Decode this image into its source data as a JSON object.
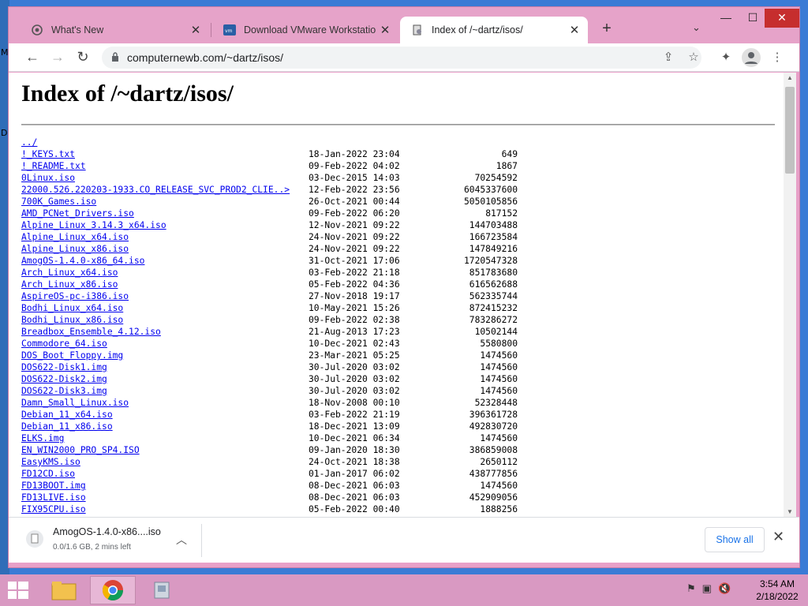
{
  "browser": {
    "tabs": [
      {
        "title": "What's New",
        "icon": "chrome-icon"
      },
      {
        "title": "Download VMware Workstation",
        "icon": "vmware-icon"
      },
      {
        "title": "Index of /~dartz/isos/",
        "icon": "page-icon"
      }
    ],
    "url": "computernewb.com/~dartz/isos/"
  },
  "page": {
    "title": "Index of /~dartz/isos/",
    "parent_link": "../",
    "entries": [
      {
        "name": "!_KEYS.txt",
        "date": "18-Jan-2022 23:04",
        "size": "649"
      },
      {
        "name": "!_README.txt",
        "date": "09-Feb-2022 04:02",
        "size": "1867"
      },
      {
        "name": "0Linux.iso",
        "date": "03-Dec-2015 14:03",
        "size": "70254592"
      },
      {
        "name": "22000.526.220203-1933.CO_RELEASE_SVC_PROD2_CLIE..>",
        "date": "12-Feb-2022 23:56",
        "size": "6045337600"
      },
      {
        "name": "700K_Games.iso",
        "date": "26-Oct-2021 00:44",
        "size": "5050105856"
      },
      {
        "name": "AMD_PCNet_Drivers.iso",
        "date": "09-Feb-2022 06:20",
        "size": "817152"
      },
      {
        "name": "Alpine_Linux_3.14.3_x64.iso",
        "date": "12-Nov-2021 09:22",
        "size": "144703488"
      },
      {
        "name": "Alpine_Linux_x64.iso",
        "date": "24-Nov-2021 09:22",
        "size": "166723584"
      },
      {
        "name": "Alpine_Linux_x86.iso",
        "date": "24-Nov-2021 09:22",
        "size": "147849216"
      },
      {
        "name": "AmogOS-1.4.0-x86_64.iso",
        "date": "31-Oct-2021 17:06",
        "size": "1720547328"
      },
      {
        "name": "Arch_Linux_x64.iso",
        "date": "03-Feb-2022 21:18",
        "size": "851783680"
      },
      {
        "name": "Arch_Linux_x86.iso",
        "date": "05-Feb-2022 04:36",
        "size": "616562688"
      },
      {
        "name": "AspireOS-pc-i386.iso",
        "date": "27-Nov-2018 19:17",
        "size": "562335744"
      },
      {
        "name": "Bodhi_Linux_x64.iso",
        "date": "10-May-2021 15:26",
        "size": "872415232"
      },
      {
        "name": "Bodhi_Linux_x86.iso",
        "date": "09-Feb-2022 02:38",
        "size": "783286272"
      },
      {
        "name": "Breadbox_Ensemble_4.12.iso",
        "date": "21-Aug-2013 17:23",
        "size": "10502144"
      },
      {
        "name": "Commodore_64.iso",
        "date": "10-Dec-2021 02:43",
        "size": "5580800"
      },
      {
        "name": "DOS_Boot_Floppy.img",
        "date": "23-Mar-2021 05:25",
        "size": "1474560"
      },
      {
        "name": "DOS622-Disk1.img",
        "date": "30-Jul-2020 03:02",
        "size": "1474560"
      },
      {
        "name": "DOS622-Disk2.img",
        "date": "30-Jul-2020 03:02",
        "size": "1474560"
      },
      {
        "name": "DOS622-Disk3.img",
        "date": "30-Jul-2020 03:02",
        "size": "1474560"
      },
      {
        "name": "Damn_Small_Linux.iso",
        "date": "18-Nov-2008 00:10",
        "size": "52328448"
      },
      {
        "name": "Debian_11_x64.iso",
        "date": "03-Feb-2022 21:19",
        "size": "396361728"
      },
      {
        "name": "Debian_11_x86.iso",
        "date": "18-Dec-2021 13:09",
        "size": "492830720"
      },
      {
        "name": "ELKS.img",
        "date": "10-Dec-2021 06:34",
        "size": "1474560"
      },
      {
        "name": "EN_WIN2000_PRO_SP4.ISO",
        "date": "09-Jan-2020 18:30",
        "size": "386859008"
      },
      {
        "name": "EasyKMS.iso",
        "date": "24-Oct-2021 18:38",
        "size": "2650112"
      },
      {
        "name": "FD12CD.iso",
        "date": "01-Jan-2017 06:02",
        "size": "438777856"
      },
      {
        "name": "FD13BOOT.img",
        "date": "08-Dec-2021 06:03",
        "size": "1474560"
      },
      {
        "name": "FD13LIVE.iso",
        "date": "08-Dec-2021 06:03",
        "size": "452909056"
      },
      {
        "name": "FIX95CPU.iso",
        "date": "05-Feb-2022 00:40",
        "size": "1888256"
      }
    ]
  },
  "download": {
    "file_name": "AmogOS-1.4.0-x86....iso",
    "status": "0.0/1.6 GB, 2 mins left",
    "show_all_label": "Show all"
  },
  "taskbar": {
    "time": "3:54 AM",
    "date": "2/18/2022"
  }
}
